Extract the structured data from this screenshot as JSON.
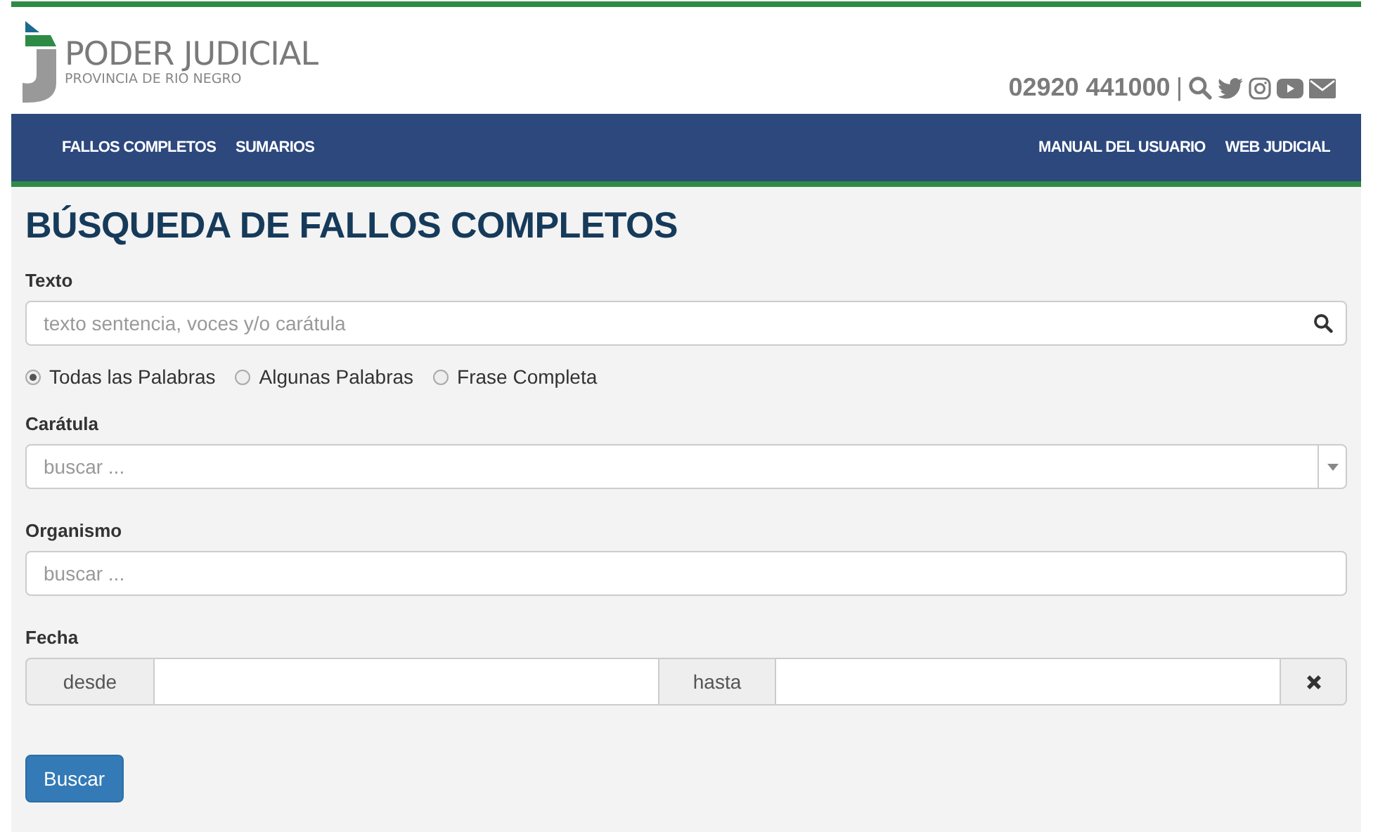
{
  "header": {
    "logo_title": "PODER JUDICIAL",
    "logo_subtitle": "PROVINCIA DE RIO NEGRO",
    "phone": "02920 441000",
    "separator": "|"
  },
  "nav": {
    "left": [
      "FALLOS COMPLETOS",
      "SUMARIOS"
    ],
    "right": [
      "MANUAL DEL USUARIO",
      "WEB JUDICIAL"
    ]
  },
  "page_title": "BÚSQUEDA DE FALLOS COMPLETOS",
  "texto": {
    "label": "Texto",
    "placeholder": "texto sentencia, voces y/o carátula"
  },
  "match_options": [
    {
      "label": "Todas las Palabras",
      "selected": true
    },
    {
      "label": "Algunas Palabras",
      "selected": false
    },
    {
      "label": "Frase Completa",
      "selected": false
    }
  ],
  "caratula": {
    "label": "Carátula",
    "placeholder": "buscar ..."
  },
  "organismo": {
    "label": "Organismo",
    "placeholder": "buscar ..."
  },
  "fecha": {
    "label": "Fecha",
    "from_label": "desde",
    "to_label": "hasta"
  },
  "submit": "Buscar"
}
